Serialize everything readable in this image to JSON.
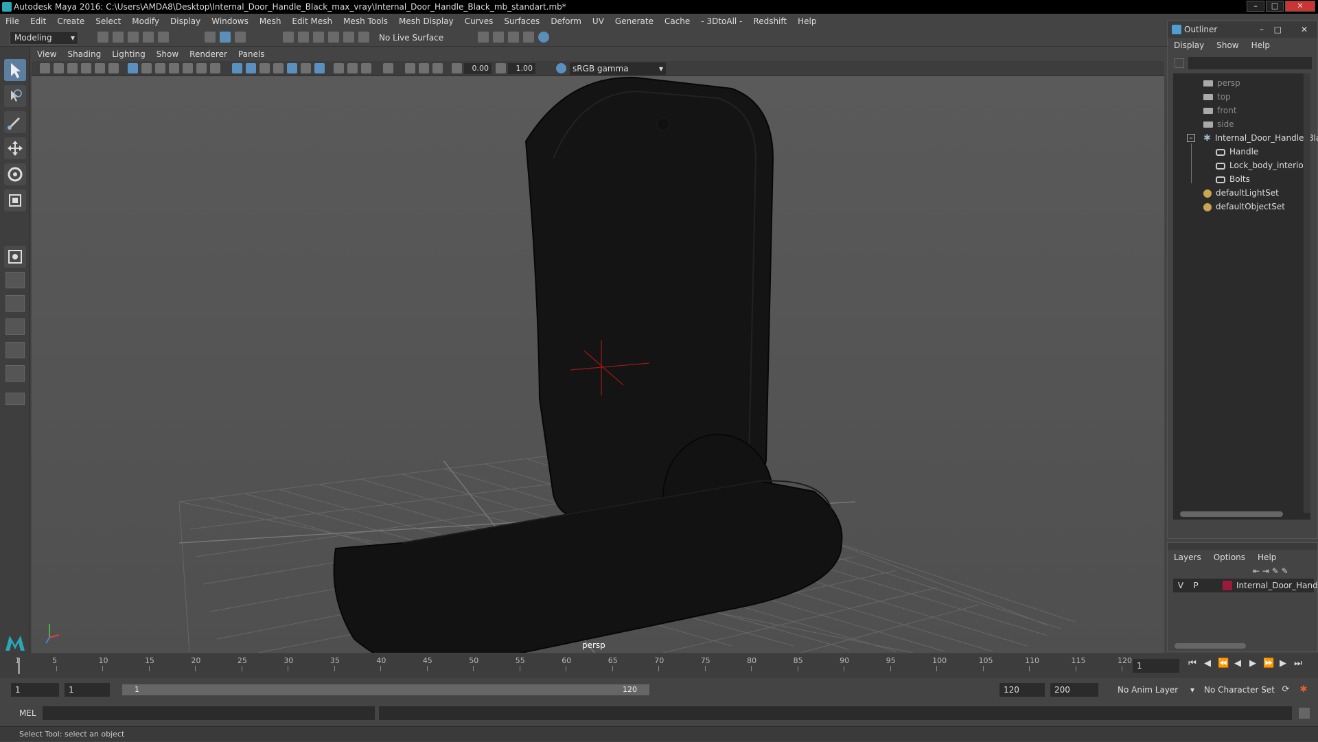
{
  "window": {
    "title": "Autodesk Maya 2016: C:\\Users\\AMDA8\\Desktop\\Internal_Door_Handle_Black_max_vray\\Internal_Door_Handle_Black_mb_standart.mb*"
  },
  "menu": [
    "File",
    "Edit",
    "Create",
    "Select",
    "Modify",
    "Display",
    "Windows",
    "Mesh",
    "Edit Mesh",
    "Mesh Tools",
    "Mesh Display",
    "Curves",
    "Surfaces",
    "Deform",
    "UV",
    "Generate",
    "Cache",
    "- 3DtoAll -",
    "Redshift",
    "Help"
  ],
  "shelf": {
    "mode": "Modeling",
    "live_surface": "No Live Surface"
  },
  "panel_menu": [
    "View",
    "Shading",
    "Lighting",
    "Show",
    "Renderer",
    "Panels"
  ],
  "panel_toolbar": {
    "exposure": "0.00",
    "gamma": "1.00",
    "color_space": "sRGB gamma"
  },
  "viewport": {
    "camera_label": "persp"
  },
  "outliner": {
    "title": "Outliner",
    "menu": [
      "Display",
      "Show",
      "Help"
    ],
    "items": [
      {
        "label": "persp",
        "type": "camera",
        "dim": true
      },
      {
        "label": "top",
        "type": "camera",
        "dim": true
      },
      {
        "label": "front",
        "type": "camera",
        "dim": true
      },
      {
        "label": "side",
        "type": "camera",
        "dim": true
      },
      {
        "label": "Internal_Door_Handle_Bla",
        "type": "group",
        "dim": false
      },
      {
        "label": "Handle",
        "type": "mesh",
        "dim": false
      },
      {
        "label": "Lock_body_interior",
        "type": "mesh",
        "dim": false
      },
      {
        "label": "Bolts",
        "type": "mesh",
        "dim": false
      },
      {
        "label": "defaultLightSet",
        "type": "set",
        "dim": false
      },
      {
        "label": "defaultObjectSet",
        "type": "set",
        "dim": false
      }
    ]
  },
  "layers": {
    "menu": [
      "Layers",
      "Options",
      "Help"
    ],
    "row": {
      "v": "V",
      "p": "P",
      "name": "Internal_Door_Handle_"
    }
  },
  "timeline": {
    "ticks": [
      1,
      5,
      10,
      15,
      20,
      25,
      30,
      35,
      40,
      45,
      50,
      55,
      60,
      65,
      70,
      75,
      80,
      85,
      90,
      95,
      100,
      105,
      110,
      115,
      120
    ],
    "current_frame": "1"
  },
  "range": {
    "start": "1",
    "playback_start": "1",
    "slider_start": "1",
    "slider_end": "120",
    "playback_end": "120",
    "end": "200",
    "anim_layer": "No Anim Layer",
    "character_set": "No Character Set"
  },
  "command_line": {
    "label": "MEL"
  },
  "help_line": "Select Tool: select an object",
  "colors": {
    "accent": "#5a90c0",
    "layer_color": "#9b1a3a"
  }
}
